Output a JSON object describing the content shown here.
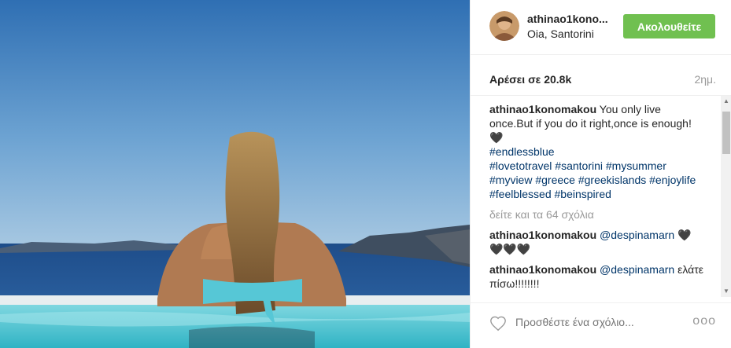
{
  "post": {
    "username": "athinao1kono...",
    "location": "Oia, Santorini",
    "follow_label": "Ακολουθείτε",
    "likes": "Αρέσει σε 20.8k",
    "time": "2ημ."
  },
  "caption": {
    "user": "athinao1konomakou",
    "text": " You only live once.But if you do it right,once is enough!🖤",
    "tags": [
      "#endlessblue",
      "#lovetotravel",
      "#santorini",
      "#mysummer",
      "#myview",
      "#greece",
      "#greekislands",
      "#enjoylife",
      "#feelblessed",
      "#beinspired"
    ]
  },
  "view_all": "δείτε και τα 64 σχόλια",
  "comments": [
    {
      "user": "athinao1konomakou",
      "mention": "@despinamarn",
      "text": " 🖤🖤🖤🖤"
    },
    {
      "user": "athinao1konomakou",
      "mention": "@despinamarn",
      "text": " ελάτε πίσω!!!!!!!!"
    }
  ],
  "footer": {
    "placeholder": "Προσθέστε ένα σχόλιο...",
    "more": "ooo"
  },
  "icons": {
    "heart": "heart-icon",
    "more": "more-options-icon",
    "scroll_up": "scroll-up-icon",
    "scroll_down": "scroll-down-icon"
  },
  "colors": {
    "follow_bg": "#70c050",
    "hashtag": "#003569",
    "muted": "#999999"
  }
}
